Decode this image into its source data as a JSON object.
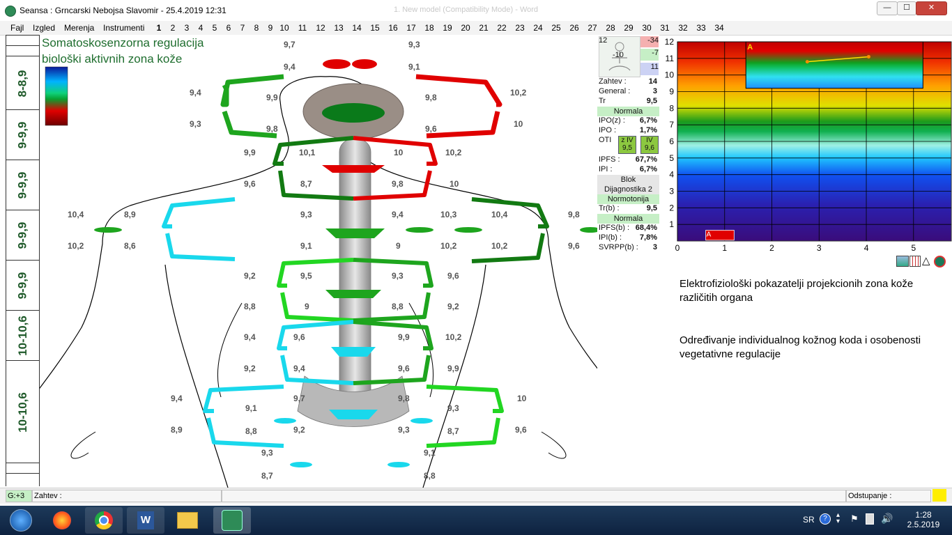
{
  "window": {
    "title": "Seansa : Grncarski Nebojsa Slavomir - 25.4.2019 12:31",
    "ghost_title": "1. New model (Compatibility Mode) - Word",
    "minimize": "—",
    "maximize": "☐",
    "close": "✕"
  },
  "menu": {
    "items": [
      "Fajl",
      "Izgled",
      "Merenja",
      "Instrumenti"
    ],
    "tabs": [
      "1",
      "2",
      "3",
      "4",
      "5",
      "6",
      "7",
      "8",
      "9",
      "10",
      "11",
      "12",
      "13",
      "14",
      "15",
      "16",
      "17",
      "18",
      "19",
      "20",
      "21",
      "22",
      "23",
      "24",
      "25",
      "26",
      "27",
      "28",
      "29",
      "30",
      "31",
      "32",
      "33",
      "34"
    ]
  },
  "left_codes": [
    "8-8,9",
    "9-9,9",
    "9-9,9",
    "9-9,9",
    "9-9,9",
    "10-10,6",
    "10-10,6"
  ],
  "body": {
    "heading_line1": "Somatoskosenzorna regulacija",
    "heading_line2": "biološki aktivnih zona kože",
    "labels": [
      {
        "t": "9,7",
        "x": 350,
        "y": 7
      },
      {
        "t": "9,3",
        "x": 529,
        "y": 7
      },
      {
        "t": "9,4",
        "x": 350,
        "y": 39
      },
      {
        "t": "9,1",
        "x": 529,
        "y": 39
      },
      {
        "t": "9,4",
        "x": 215,
        "y": 76
      },
      {
        "t": "9,9",
        "x": 325,
        "y": 83
      },
      {
        "t": "9,8",
        "x": 553,
        "y": 83
      },
      {
        "t": "10,2",
        "x": 675,
        "y": 76
      },
      {
        "t": "9,3",
        "x": 215,
        "y": 121
      },
      {
        "t": "9,8",
        "x": 325,
        "y": 128
      },
      {
        "t": "9,6",
        "x": 553,
        "y": 128
      },
      {
        "t": "10",
        "x": 680,
        "y": 121
      },
      {
        "t": "9,9",
        "x": 293,
        "y": 162
      },
      {
        "t": "10,1",
        "x": 372,
        "y": 162
      },
      {
        "t": "10",
        "x": 508,
        "y": 162
      },
      {
        "t": "10,2",
        "x": 582,
        "y": 162
      },
      {
        "t": "9,6",
        "x": 293,
        "y": 207
      },
      {
        "t": "8,7",
        "x": 374,
        "y": 207
      },
      {
        "t": "9,8",
        "x": 505,
        "y": 207
      },
      {
        "t": "10",
        "x": 588,
        "y": 207
      },
      {
        "t": "10,4",
        "x": 40,
        "y": 251
      },
      {
        "t": "8,9",
        "x": 121,
        "y": 251
      },
      {
        "t": "9,3",
        "x": 374,
        "y": 251
      },
      {
        "t": "9,4",
        "x": 505,
        "y": 251
      },
      {
        "t": "10,3",
        "x": 575,
        "y": 251
      },
      {
        "t": "10,4",
        "x": 648,
        "y": 251
      },
      {
        "t": "9,8",
        "x": 758,
        "y": 251
      },
      {
        "t": "10,2",
        "x": 40,
        "y": 296
      },
      {
        "t": "8,6",
        "x": 121,
        "y": 296
      },
      {
        "t": "9,1",
        "x": 374,
        "y": 296
      },
      {
        "t": "9",
        "x": 511,
        "y": 296
      },
      {
        "t": "10,2",
        "x": 575,
        "y": 296
      },
      {
        "t": "10,2",
        "x": 648,
        "y": 296
      },
      {
        "t": "9,6",
        "x": 758,
        "y": 296
      },
      {
        "t": "9,2",
        "x": 293,
        "y": 339
      },
      {
        "t": "9,5",
        "x": 374,
        "y": 339
      },
      {
        "t": "9,3",
        "x": 505,
        "y": 339
      },
      {
        "t": "9,6",
        "x": 585,
        "y": 339
      },
      {
        "t": "8,8",
        "x": 293,
        "y": 383
      },
      {
        "t": "9",
        "x": 380,
        "y": 383
      },
      {
        "t": "8,8",
        "x": 505,
        "y": 383
      },
      {
        "t": "9,2",
        "x": 585,
        "y": 383
      },
      {
        "t": "9,4",
        "x": 293,
        "y": 427
      },
      {
        "t": "9,6",
        "x": 364,
        "y": 427
      },
      {
        "t": "9,9",
        "x": 514,
        "y": 427
      },
      {
        "t": "10,2",
        "x": 582,
        "y": 427
      },
      {
        "t": "9,2",
        "x": 293,
        "y": 472
      },
      {
        "t": "9,4",
        "x": 364,
        "y": 472
      },
      {
        "t": "9,6",
        "x": 514,
        "y": 472
      },
      {
        "t": "9,9",
        "x": 585,
        "y": 472
      },
      {
        "t": "9,4",
        "x": 188,
        "y": 515
      },
      {
        "t": "9,7",
        "x": 364,
        "y": 515
      },
      {
        "t": "9,8",
        "x": 514,
        "y": 515
      },
      {
        "t": "10",
        "x": 685,
        "y": 515
      },
      {
        "t": "9,1",
        "x": 295,
        "y": 529
      },
      {
        "t": "9,3",
        "x": 585,
        "y": 529
      },
      {
        "t": "8,9",
        "x": 188,
        "y": 560
      },
      {
        "t": "8,8",
        "x": 295,
        "y": 562
      },
      {
        "t": "9,2",
        "x": 364,
        "y": 560
      },
      {
        "t": "9,3",
        "x": 514,
        "y": 560
      },
      {
        "t": "8,7",
        "x": 585,
        "y": 562
      },
      {
        "t": "9,6",
        "x": 682,
        "y": 560
      },
      {
        "t": "9,3",
        "x": 318,
        "y": 593
      },
      {
        "t": "9,1",
        "x": 551,
        "y": 593
      },
      {
        "t": "8,7",
        "x": 318,
        "y": 626
      },
      {
        "t": "8,8",
        "x": 551,
        "y": 626
      }
    ]
  },
  "info_panel": {
    "top_values": [
      "12",
      "-34",
      "-10",
      "-7",
      "11"
    ],
    "rows": [
      {
        "k": "Zahtev :",
        "v": "14"
      },
      {
        "k": "General :",
        "v": "3"
      },
      {
        "k": "Tr",
        "v": "9,5"
      },
      {
        "band": "Normala"
      },
      {
        "k": "IPO(z) :",
        "v": "6,7%"
      },
      {
        "k": "IPO :",
        "v": "1,7%"
      },
      {
        "k": "OTI",
        "oti": [
          "z IV",
          "9,5",
          "IV",
          "9,6"
        ]
      },
      {
        "k": "IPFS :",
        "v": "67,7%"
      },
      {
        "k": "IPI :",
        "v": "6,7%"
      },
      {
        "band": "Blok"
      },
      {
        "band": "Dijagnostika 2"
      },
      {
        "band": "Normotonija"
      },
      {
        "k": "Tr(b) :",
        "v": "9,5"
      },
      {
        "band": "Normala"
      },
      {
        "k": "IPFS(b) :",
        "v": "68,4%"
      },
      {
        "k": "IPI(b) :",
        "v": "7,8%"
      },
      {
        "k": "SVRPP(b) :",
        "v": "3"
      }
    ]
  },
  "chart_data": {
    "type": "line",
    "title": "",
    "xlabel": "",
    "ylabel": "",
    "xlim": [
      0,
      5.8
    ],
    "ylim": [
      0,
      12
    ],
    "xticks": [
      0,
      1,
      2,
      3,
      4,
      5
    ],
    "yticks": [
      1,
      2,
      3,
      4,
      5,
      6,
      7,
      8,
      9,
      10,
      11,
      12
    ],
    "inset_label": "A",
    "series": [
      {
        "name": "A",
        "x": [
          2.75,
          4.05
        ],
        "y": [
          10.8,
          11.1
        ]
      }
    ],
    "bar_marker": {
      "label": "A",
      "x0": 0.6,
      "x1": 1.2,
      "y0": 0.05,
      "y1": 0.65
    }
  },
  "right_texts": [
    "Elektrofiziološki pokazatelji projekcionih zona kože različitih organa",
    "Određivanje individualnog kožnog koda i osobenosti vegetativne regulacije"
  ],
  "status": {
    "g": "G:+3",
    "zahtev": "Zahtev :",
    "odstupanje": "Odstupanje :"
  },
  "tray": {
    "lang": "SR",
    "time": "1:28",
    "date": "2.5.2019"
  },
  "colors": {
    "green": "#1ea51e",
    "dark_green": "#127a12",
    "light_green": "#22d622",
    "red": "#e00000",
    "cyan": "#19d8ec",
    "heading": "#1f6e2f"
  }
}
